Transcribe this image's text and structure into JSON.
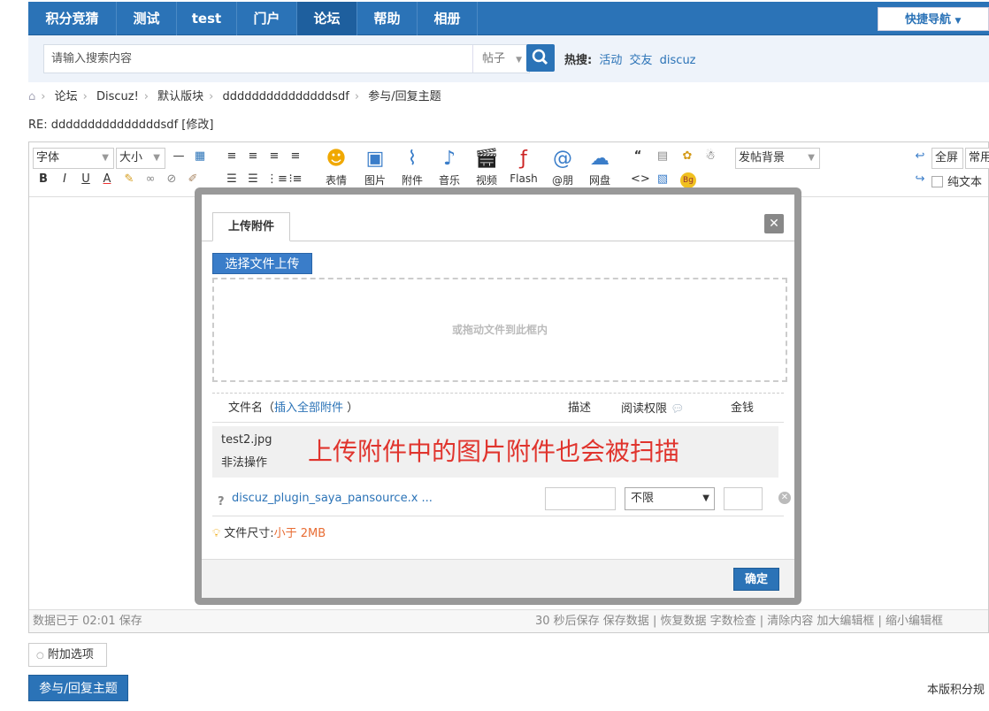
{
  "nav": {
    "items": [
      "积分竞猜",
      "测试",
      "test",
      "门户",
      "论坛",
      "帮助",
      "相册"
    ],
    "active": "论坛",
    "quick_nav": "快捷导航"
  },
  "search": {
    "placeholder": "请输入搜索内容",
    "type": "帖子",
    "hot_label": "热搜:",
    "hot_items": [
      "活动",
      "交友",
      "discuz"
    ]
  },
  "breadcrumb": [
    "论坛",
    "Discuz!",
    "默认版块",
    "dddddddddddddddsdf",
    "参与/回复主题"
  ],
  "reply_title": "RE: dddddddddddddddsdf [修改]",
  "editor": {
    "font_select": "字体",
    "size_select": "大小",
    "bg_select": "发帖背景",
    "big_tools": [
      "表情",
      "图片",
      "附件",
      "音乐",
      "视频",
      "Flash",
      "@朋",
      "网盘"
    ],
    "fullscreen": "全屏",
    "common": "常用",
    "plain_text": "纯文本",
    "status_left": "数据已于 02:01 保存",
    "status_right": "30 秒后保存 保存数据 | 恢复数据    字数检查 | 清除内容    加大编辑框 | 缩小编辑框"
  },
  "modal": {
    "tab": "上传附件",
    "choose_button": "选择文件上传",
    "drop_hint": "或拖动文件到此框内",
    "col_filename": "文件名",
    "insert_all": "插入全部附件",
    "col_desc": "描述",
    "col_perm": "阅读权限",
    "col_money": "金钱",
    "file1_name": "test2.jpg",
    "file1_error": "非法操作",
    "annotation": "上传附件中的图片附件也会被扫描",
    "file2_name": "discuz_plugin_saya_pansource.x ...",
    "file2_perm": "不限",
    "size_label": "文件尺寸:",
    "size_value": "小于 2MB",
    "ok": "确定"
  },
  "extra_options": "附加选项",
  "submit": "参与/回复主题",
  "rules_text": "本版积分规"
}
